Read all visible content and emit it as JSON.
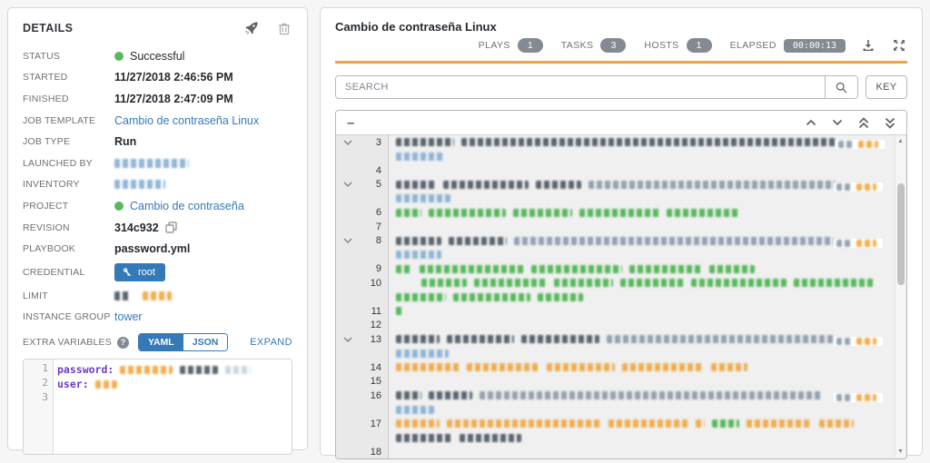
{
  "colors": {
    "dark": "#4a5560",
    "mid": "#8a99a8",
    "blue": "#85aed1",
    "green": "#46b24a",
    "orange": "#f0a63f",
    "light": "#c9d4dc",
    "link": "#337ab7",
    "status_green": "#5cb85c",
    "accent_orange": "#f5a23c",
    "badge_gray": "#848992"
  },
  "icons": [
    "rocket-icon",
    "trash-icon",
    "copy-icon",
    "key-icon",
    "question-icon",
    "download-icon",
    "expand-icon",
    "search-icon",
    "chevron-up-icon",
    "chevron-down-icon",
    "double-chevron-up-icon",
    "double-chevron-down-icon",
    "expander-chevron-icon"
  ],
  "details": {
    "title": "DETAILS",
    "rows": [
      {
        "label": "STATUS",
        "type": "status",
        "value": "Successful"
      },
      {
        "label": "STARTED",
        "type": "text",
        "value": "11/27/2018 2:46:56 PM"
      },
      {
        "label": "FINISHED",
        "type": "text",
        "value": "11/27/2018 2:47:09 PM"
      },
      {
        "label": "JOB TEMPLATE",
        "type": "link",
        "value": "Cambio de contraseña Linux"
      },
      {
        "label": "JOB TYPE",
        "type": "text",
        "value": "Run"
      },
      {
        "label": "LAUNCHED BY",
        "type": "redacted",
        "segs": [
          [
            82,
            "blue"
          ]
        ]
      },
      {
        "label": "INVENTORY",
        "type": "redacted",
        "segs": [
          [
            56,
            "blue"
          ]
        ]
      },
      {
        "label": "PROJECT",
        "type": "status-link",
        "value": "Cambio de contraseña"
      },
      {
        "label": "REVISION",
        "type": "copy",
        "value": "314c932"
      },
      {
        "label": "PLAYBOOK",
        "type": "text",
        "value": "password.yml"
      },
      {
        "label": "CREDENTIAL",
        "type": "credential",
        "value": "root"
      },
      {
        "label": "LIMIT",
        "type": "redacted",
        "segs": [
          [
            16,
            "dark"
          ],
          [
            32,
            "orange"
          ]
        ]
      },
      {
        "label": "INSTANCE GROUP",
        "type": "link",
        "value": "tower"
      }
    ],
    "extra_variables": {
      "label": "EXTRA VARIABLES",
      "toggle": [
        "YAML",
        "JSON"
      ],
      "active": "YAML",
      "expand_label": "EXPAND",
      "editor_lines": [
        {
          "n": "1",
          "key": "password:",
          "segs": [
            [
              58,
              "orange"
            ],
            [
              42,
              "dark"
            ],
            [
              28,
              "light"
            ]
          ]
        },
        {
          "n": "2",
          "key": "user:",
          "segs": [
            [
              24,
              "orange"
            ]
          ]
        },
        {
          "n": "3",
          "key": "",
          "segs": []
        }
      ]
    }
  },
  "job": {
    "title": "Cambio de contraseña Linux",
    "stats": [
      {
        "label": "PLAYS",
        "value": "1"
      },
      {
        "label": "TASKS",
        "value": "3"
      },
      {
        "label": "HOSTS",
        "value": "1"
      },
      {
        "label": "ELAPSED",
        "value": "00:00:13"
      }
    ]
  },
  "search": {
    "placeholder": "SEARCH",
    "key_button": "KEY"
  },
  "output": {
    "collapse_label": "–",
    "lines": [
      {
        "n": "3",
        "expand": true,
        "rows": [
          {
            "segs": [
              [
                64,
                "dark"
              ],
              [
                414,
                "dark"
              ]
            ],
            "ts": true
          },
          {
            "segs": [
              [
                54,
                "blue"
              ]
            ]
          }
        ]
      },
      {
        "n": "4",
        "rows": [
          {
            "segs": []
          }
        ]
      },
      {
        "n": "5",
        "expand": true,
        "rows": [
          {
            "segs": [
              [
                44,
                "dark"
              ],
              [
                94,
                "dark"
              ],
              [
                50,
                "dark"
              ],
              [
                272,
                "mid"
              ]
            ],
            "ts": true
          },
          {
            "segs": [
              [
                60,
                "blue"
              ]
            ]
          }
        ]
      },
      {
        "n": "6",
        "rows": [
          {
            "segs": [
              [
                28,
                "green"
              ],
              [
                85,
                "green"
              ],
              [
                65,
                "green"
              ],
              [
                88,
                "green"
              ],
              [
                80,
                "green"
              ]
            ]
          }
        ]
      },
      {
        "n": "7",
        "rows": [
          {
            "segs": []
          }
        ]
      },
      {
        "n": "8",
        "expand": true,
        "rows": [
          {
            "segs": [
              [
                50,
                "dark"
              ],
              [
                64,
                "dark"
              ],
              [
                352,
                "mid"
              ]
            ],
            "ts": true
          },
          {
            "segs": [
              [
                50,
                "blue"
              ]
            ]
          }
        ]
      },
      {
        "n": "9",
        "rows": [
          {
            "segs": [
              [
                18,
                "green"
              ],
              [
                115,
                "green"
              ],
              [
                100,
                "green"
              ],
              [
                80,
                "green"
              ],
              [
                50,
                "green"
              ]
            ]
          }
        ]
      },
      {
        "n": "10",
        "rows": [
          {
            "indent": 28,
            "segs": [
              [
                50,
                "green"
              ],
              [
                80,
                "green"
              ],
              [
                65,
                "green"
              ],
              [
                70,
                "green"
              ],
              [
                105,
                "green"
              ],
              [
                90,
                "green"
              ]
            ]
          },
          {
            "segs": [
              [
                55,
                "green"
              ],
              [
                85,
                "green"
              ],
              [
                50,
                "green"
              ]
            ]
          }
        ]
      },
      {
        "n": "11",
        "rows": [
          {
            "segs": [
              [
                8,
                "green"
              ]
            ]
          }
        ]
      },
      {
        "n": "12",
        "rows": [
          {
            "segs": []
          }
        ]
      },
      {
        "n": "13",
        "expand": true,
        "rows": [
          {
            "segs": [
              [
                48,
                "dark"
              ],
              [
                74,
                "dark"
              ],
              [
                86,
                "dark"
              ],
              [
                250,
                "mid"
              ]
            ],
            "ts": true
          },
          {
            "segs": [
              [
                58,
                "blue"
              ]
            ]
          }
        ]
      },
      {
        "n": "14",
        "rows": [
          {
            "segs": [
              [
                70,
                "orange"
              ],
              [
                80,
                "orange"
              ],
              [
                75,
                "orange"
              ],
              [
                90,
                "orange"
              ],
              [
                40,
                "orange"
              ]
            ]
          }
        ]
      },
      {
        "n": "15",
        "rows": [
          {
            "segs": []
          }
        ]
      },
      {
        "n": "16",
        "rows": [
          {
            "segs": [
              [
                28,
                "dark"
              ],
              [
                48,
                "dark"
              ],
              [
                378,
                "mid"
              ]
            ],
            "ts": true
          },
          {
            "segs": [
              [
                42,
                "blue"
              ]
            ]
          }
        ]
      },
      {
        "n": "17",
        "rows": [
          {
            "segs": [
              [
                48,
                "orange"
              ],
              [
                170,
                "orange"
              ],
              [
                88,
                "orange"
              ],
              [
                10,
                "orange"
              ],
              [
                30,
                "green"
              ],
              [
                72,
                "orange"
              ],
              [
                38,
                "orange"
              ]
            ]
          },
          {
            "segs": [
              [
                62,
                "dark"
              ],
              [
                68,
                "dark"
              ]
            ]
          }
        ]
      },
      {
        "n": "18",
        "rows": [
          {
            "segs": []
          }
        ]
      }
    ]
  }
}
